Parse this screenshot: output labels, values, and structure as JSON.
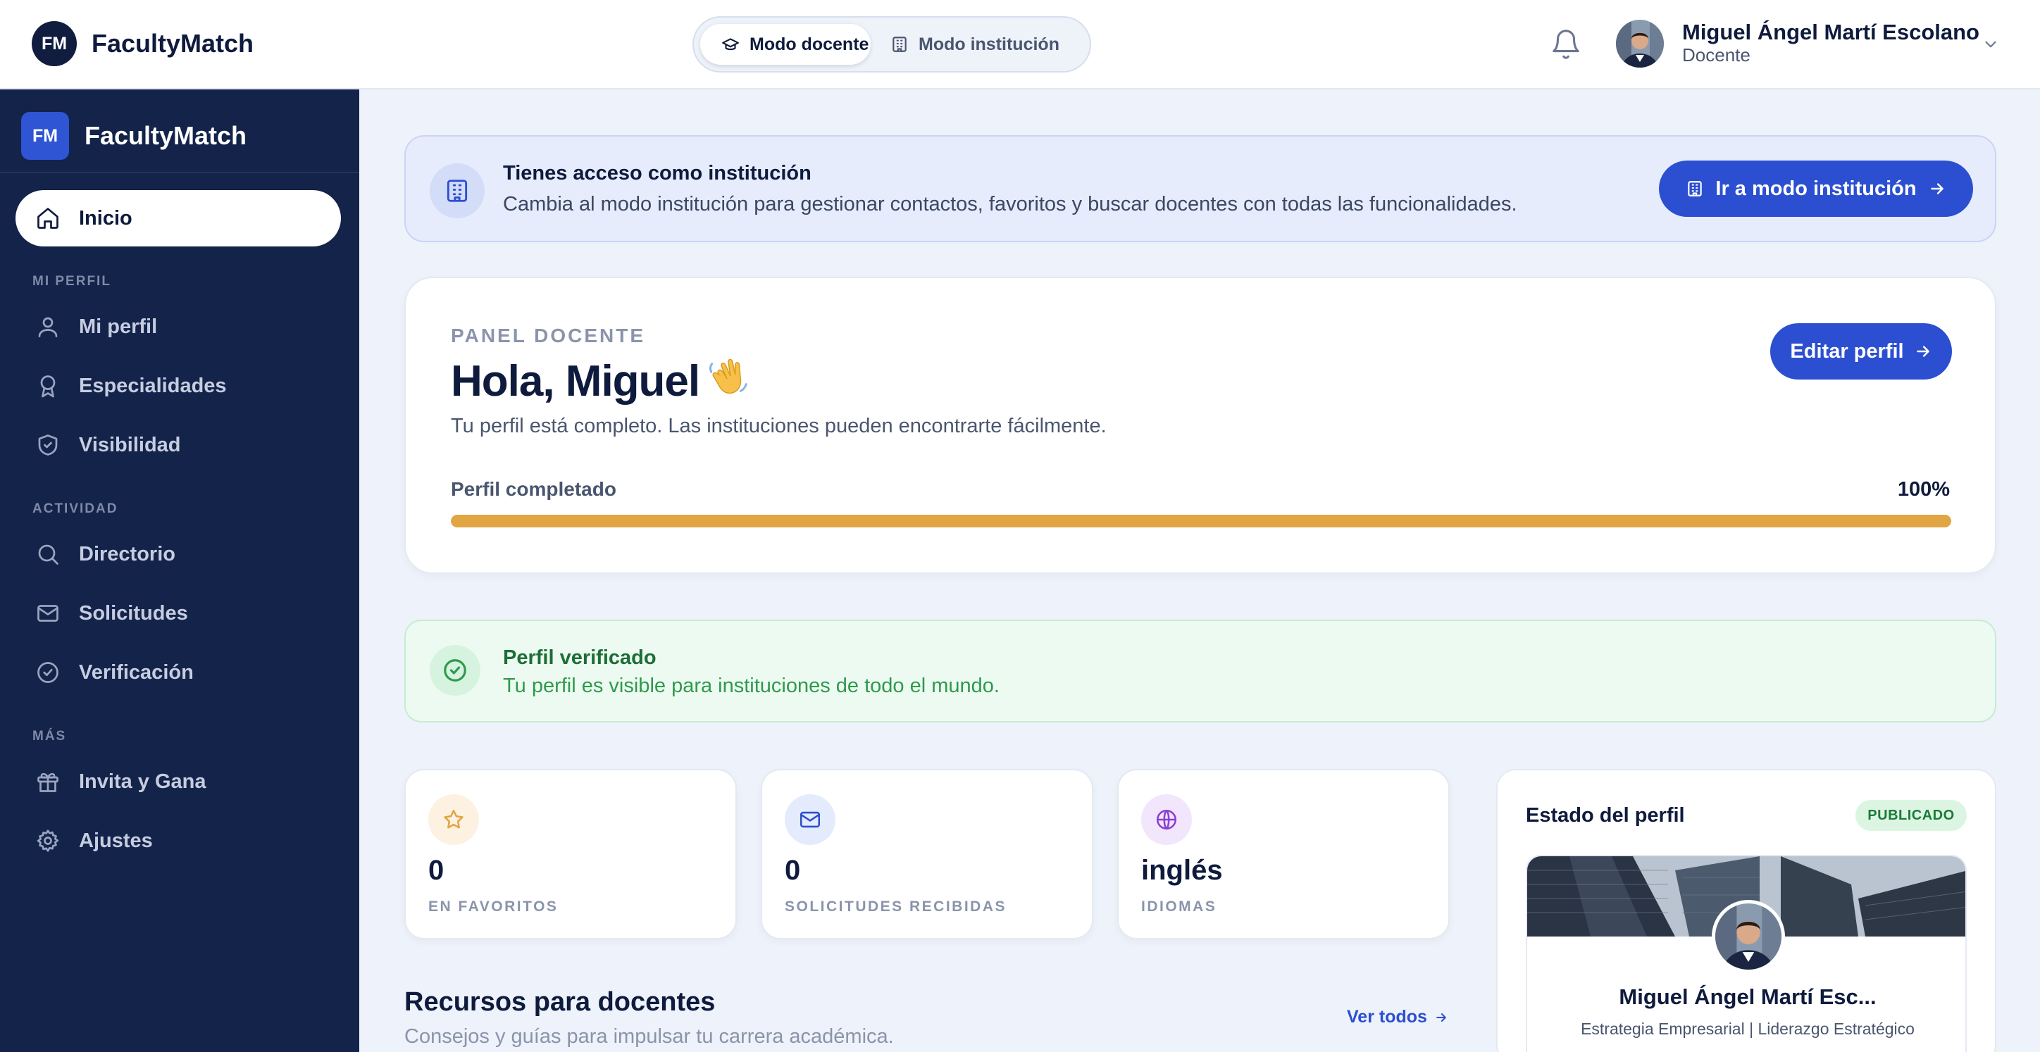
{
  "app": {
    "logo_initials": "FM",
    "name": "FacultyMatch"
  },
  "topbar": {
    "mode_docente": "Modo docente",
    "mode_institucion": "Modo institución",
    "user_name": "Miguel Ángel Martí Escolano",
    "user_role": "Docente"
  },
  "sidebar": {
    "logo_initials": "FM",
    "brand": "FacultyMatch",
    "home": "Inicio",
    "section_profile": "MI PERFIL",
    "profile_items": [
      "Mi perfil",
      "Especialidades",
      "Visibilidad"
    ],
    "section_activity": "ACTIVIDAD",
    "activity_items": [
      "Directorio",
      "Solicitudes",
      "Verificación"
    ],
    "section_more": "MÁS",
    "more_items": [
      "Invita y Gana",
      "Ajustes"
    ]
  },
  "banner": {
    "title": "Tienes acceso como institución",
    "text": "Cambia al modo institución para gestionar contactos, favoritos y buscar docentes con todas las funcionalidades.",
    "button": "Ir a modo institución"
  },
  "panel": {
    "eyebrow": "PANEL DOCENTE",
    "greeting": "Hola, Miguel",
    "emoji": "👋",
    "description": "Tu perfil está completo. Las instituciones pueden encontrarte fácilmente.",
    "edit_button": "Editar perfil",
    "progress_label": "Perfil completado",
    "progress_text": "100%",
    "progress_value": 1.0
  },
  "verified": {
    "title": "Perfil verificado",
    "text": "Tu perfil es visible para instituciones de todo el mundo."
  },
  "stats": [
    {
      "value": "0",
      "label": "EN FAVORITOS",
      "icon": "star-icon"
    },
    {
      "value": "0",
      "label": "SOLICITUDES RECIBIDAS",
      "icon": "mail-icon"
    },
    {
      "value": "inglés",
      "label": "IDIOMAS",
      "icon": "globe-icon"
    }
  ],
  "estado": {
    "title": "Estado del perfil",
    "badge": "PUBLICADO",
    "name": "Miguel Ángel Martí Esc...",
    "tagline": "Estrategia Empresarial | Liderazgo Estratégico"
  },
  "resources": {
    "title": "Recursos para docentes",
    "subtitle": "Consejos y guías para impulsar tu carrera académica.",
    "link": "Ver todos"
  },
  "colors": {
    "navy": "#14234a",
    "primary": "#2c4fd1",
    "progress": "#e1a544",
    "success": "#2f9a4c"
  }
}
